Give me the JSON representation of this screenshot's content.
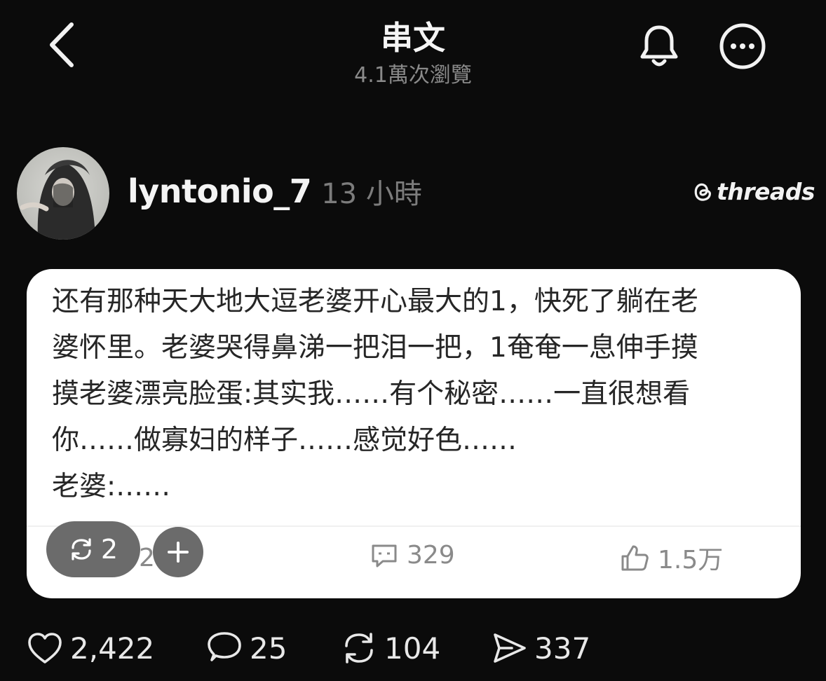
{
  "header": {
    "title": "串文",
    "subtitle": "4.1萬次瀏覽"
  },
  "post": {
    "username": "lyntonio_7",
    "time": "13 小時",
    "brand": "threads"
  },
  "card": {
    "text": "还有那种天大地大逗老婆开心最大的1，快死了躺在老\n婆怀里。老婆哭得鼻涕一把泪一把，1奄奄一息伸手摸\n摸老婆漂亮脸蛋:其实我……有个秘密……一直很想看\n你……做寡妇的样子……感觉好色……\n老婆:……",
    "partial_count": "2",
    "comments": "329",
    "likes": "1.5万"
  },
  "overlay": {
    "repost_count": "2"
  },
  "actions": {
    "likes": "2,422",
    "replies": "25",
    "reposts": "104",
    "shares": "337"
  }
}
